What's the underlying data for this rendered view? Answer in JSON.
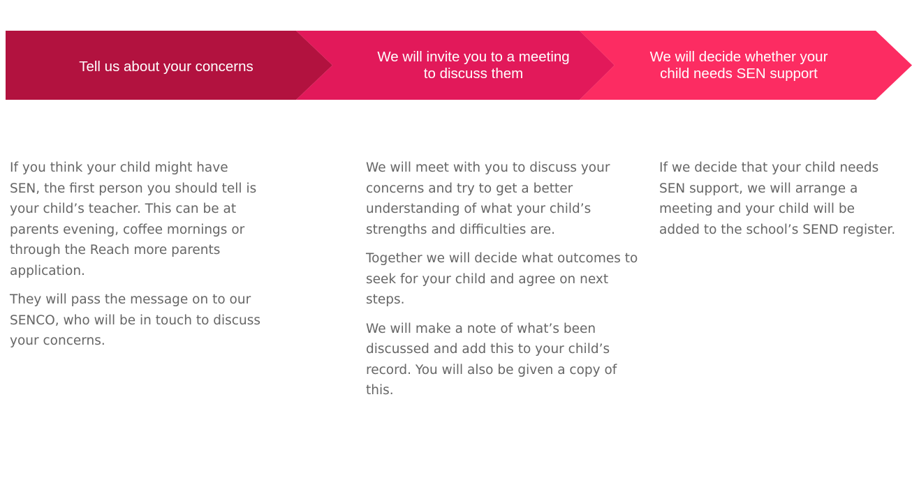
{
  "steps": [
    {
      "label": "Tell us about your concerns",
      "color": "#b2123f"
    },
    {
      "label": "We will invite you to a meeting\nto discuss them",
      "color": "#e2195a"
    },
    {
      "label": "We will decide whether your\nchild needs SEN support",
      "color": "#fc2c62"
    }
  ],
  "columns": [
    {
      "paragraphs": [
        "If you think your child might have SEN, the first person you should tell is your child’s teacher. This can be at parents evening, coffee mornings or through the Reach more parents application.",
        "They will pass the message on to our SENCO, who will be in touch to discuss your concerns."
      ]
    },
    {
      "paragraphs": [
        "We will meet with you to discuss your concerns and try to get a better understanding of what your child’s strengths and difficulties are.",
        "Together we will decide what outcomes to seek for your child and agree on next steps.",
        "We will make a note of what’s been discussed and add this to your child’s record. You will also be given a copy of this."
      ]
    },
    {
      "paragraphs": [
        "If we decide that your child needs SEN support, we will arrange a meeting and your child will be added to the school’s SEND register."
      ]
    }
  ]
}
